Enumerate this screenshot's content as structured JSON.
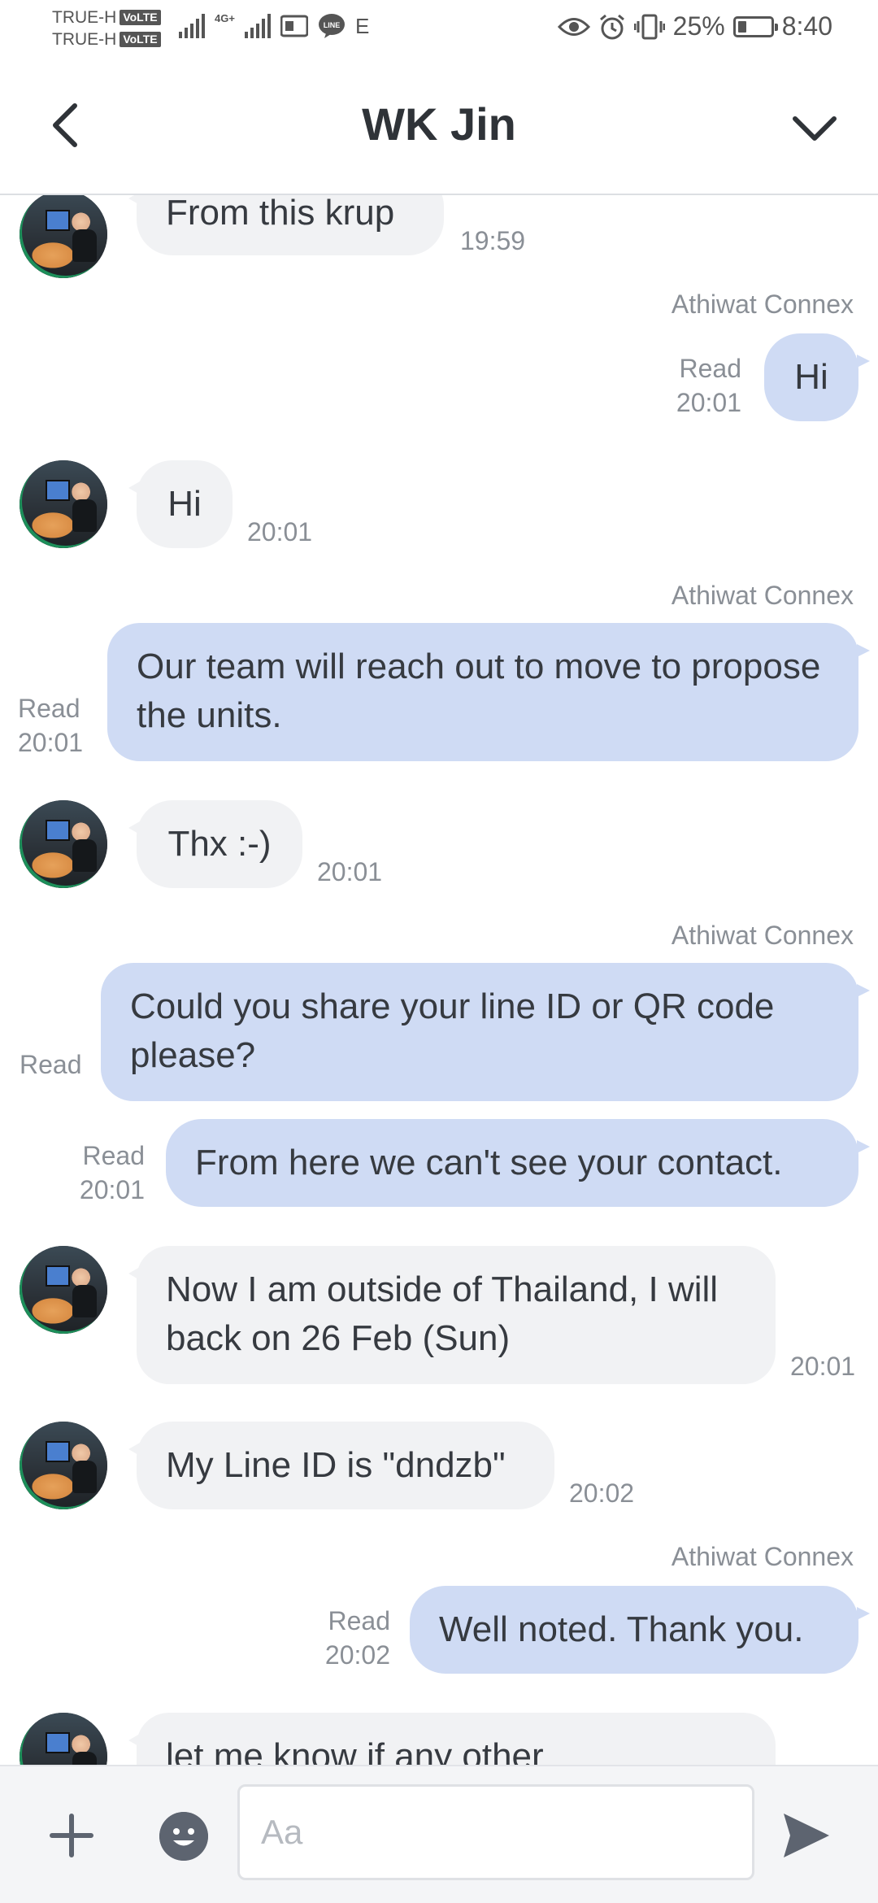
{
  "status_bar": {
    "carrier1": "TRUE-H",
    "carrier2": "TRUE-H",
    "volte": "VoLTE",
    "network": "4G+",
    "battery": "25%",
    "battery_level": 0.25,
    "time": "8:40",
    "extra_glyph": "E"
  },
  "header": {
    "title": "WK Jin",
    "back_icon": "chevron-left-icon",
    "menu_icon": "chevron-down-icon"
  },
  "messages": [
    {
      "dir": "in",
      "text": "From this krup",
      "time": "19:59"
    },
    {
      "dir": "out",
      "sender": "Athiwat Connex",
      "text": "Hi",
      "read": "Read",
      "time": "20:01"
    },
    {
      "dir": "in",
      "text": "Hi",
      "time": "20:01"
    },
    {
      "dir": "out",
      "sender": "Athiwat Connex",
      "text": "Our team will reach out to move to propose the units.",
      "read": "Read",
      "time": "20:01"
    },
    {
      "dir": "in",
      "text": "Thx :-)",
      "time": "20:01"
    },
    {
      "dir": "out",
      "sender": "Athiwat Connex",
      "text": "Could you share your line ID or QR code please?",
      "read": "Read",
      "time": ""
    },
    {
      "dir": "out",
      "text": "From here we can't see your contact.",
      "read": "Read",
      "time": "20:01"
    },
    {
      "dir": "in",
      "text": "Now I am outside of Thailand, I will back on 26 Feb (Sun)",
      "time": "20:01"
    },
    {
      "dir": "in",
      "text": "My Line ID is \"dndzb\"",
      "time": "20:02"
    },
    {
      "dir": "out",
      "sender": "Athiwat Connex",
      "text": "Well noted. Thank you.",
      "read": "Read",
      "time": "20:02"
    },
    {
      "dir": "in",
      "text": "let me know if any other",
      "time": ""
    }
  ],
  "input": {
    "placeholder": "Aa",
    "value": ""
  },
  "colors": {
    "outgoing_bubble": "#cfdbf4",
    "incoming_bubble": "#f1f2f4",
    "icon": "#5d6470"
  }
}
